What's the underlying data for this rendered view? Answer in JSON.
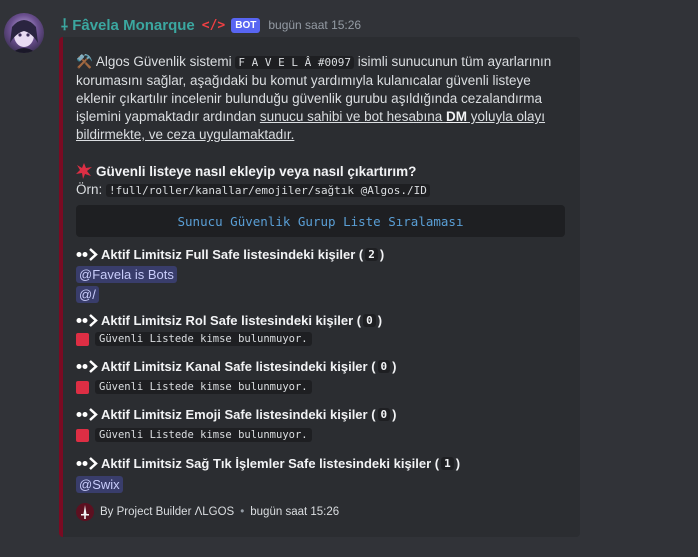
{
  "message": {
    "author": "⸸ Fâvela Monarque",
    "code_tag": "</>",
    "bot_badge": "BOT",
    "timestamp": "bugün saat 15:26"
  },
  "embed": {
    "accent_color": "#7a0a22",
    "description": {
      "prefix_emoji": "⚒️",
      "part1": " Algos Güvenlik sistemi ",
      "server_code": "F A V E L Â #0097",
      "part2": " isimli sunucunun tüm ayarlarının korumasını sağlar, aşağıdaki bu komut yardımıyla kulanıcalar güvenli listeye eklenir çıkartılır incelenir bulunduğu güvenlik gurubu aşıldığında cezalandırma işlemini yapmaktadır ardından ",
      "underlined1": "sunucu sahibi ve bot hesabına ",
      "bold_dm": "DM",
      "underlined2": " yoluyla olayı bildirmekte, ve ceza uygulamaktadır."
    },
    "question": "Güvenli listeye nasıl ekleyip veya nasıl çıkartırım?",
    "example_label": "Örn: ",
    "example_code": "!full/roller/kanallar/emojiler/sağtık @Algos./ID",
    "code_block": "Sunucu Güvenlik Gurup Liste Sıralaması",
    "sections": [
      {
        "title": "Aktif Limitsiz Full Safe listesindeki kişiler (",
        "count": "2",
        "close": ")",
        "mentions": [
          "@Favela is Bots",
          "@/"
        ]
      },
      {
        "title": "Aktif Limitsiz Rol Safe listesindeki kişiler (",
        "count": "0",
        "close": ")",
        "empty_text": "Güvenli Listede kimse bulunmuyor."
      },
      {
        "title": "Aktif Limitsiz Kanal Safe listesindeki kişiler (",
        "count": "0",
        "close": ")",
        "empty_text": "Güvenli Listede kimse bulunmuyor."
      },
      {
        "title": "Aktif Limitsiz Emoji Safe listesindeki kişiler (",
        "count": "0",
        "close": ")",
        "empty_text": "Güvenli Listede kimse bulunmuyor."
      },
      {
        "title": "Aktif Limitsiz Sağ Tık İşlemler Safe listesindeki kişiler (",
        "count": "1",
        "close": ")",
        "mentions": [
          "@Swix"
        ]
      }
    ],
    "footer": {
      "text": "By Project Builder ΛLGOS",
      "separator": "•",
      "timestamp": "bugün saat 15:26"
    }
  }
}
